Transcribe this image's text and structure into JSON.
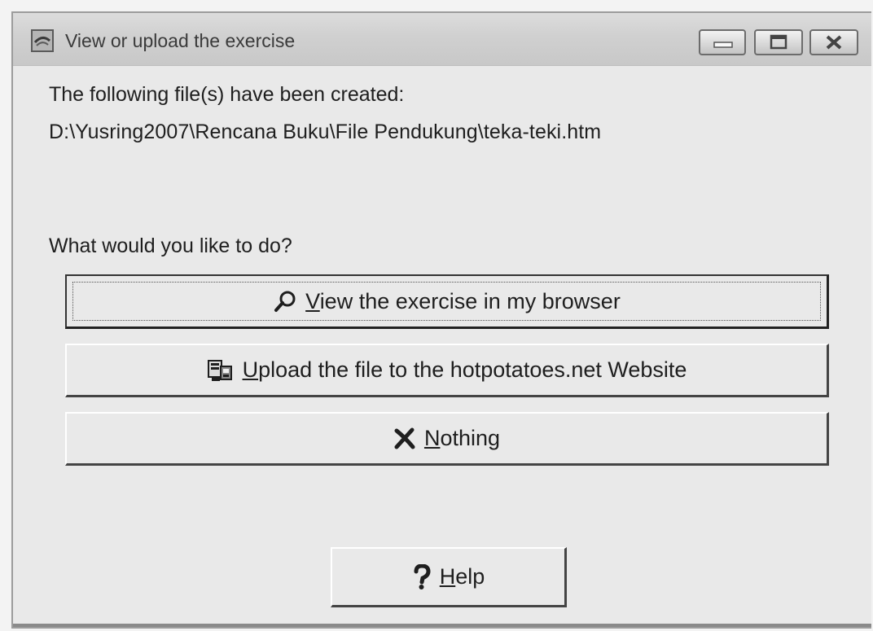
{
  "window": {
    "title": "View or upload the exercise",
    "controls": {
      "minimize_icon": "minimize-icon",
      "maximize_icon": "maximize-icon",
      "close_icon": "close-icon"
    }
  },
  "message": {
    "created_label": "The following file(s) have been created:",
    "file_path": "D:\\Yusring2007\\Rencana Buku\\File Pendukung\\teka-teki.htm",
    "prompt": "What would you like to do?"
  },
  "buttons": {
    "view": {
      "mnemonic": "V",
      "rest": "iew the exercise in my browser",
      "icon": "magnifier-icon"
    },
    "upload": {
      "mnemonic": "U",
      "rest": "pload the file to the hotpotatoes.net Website",
      "icon": "upload-icon"
    },
    "nothing": {
      "mnemonic": "N",
      "rest": "othing",
      "icon": "cross-icon"
    },
    "help": {
      "mnemonic": "H",
      "rest": "elp",
      "icon": "question-mark-icon"
    }
  },
  "colors": {
    "window_bg": "#e9e9e9",
    "titlebar_bg": "#d0d0d0",
    "text": "#1e1e1e"
  }
}
